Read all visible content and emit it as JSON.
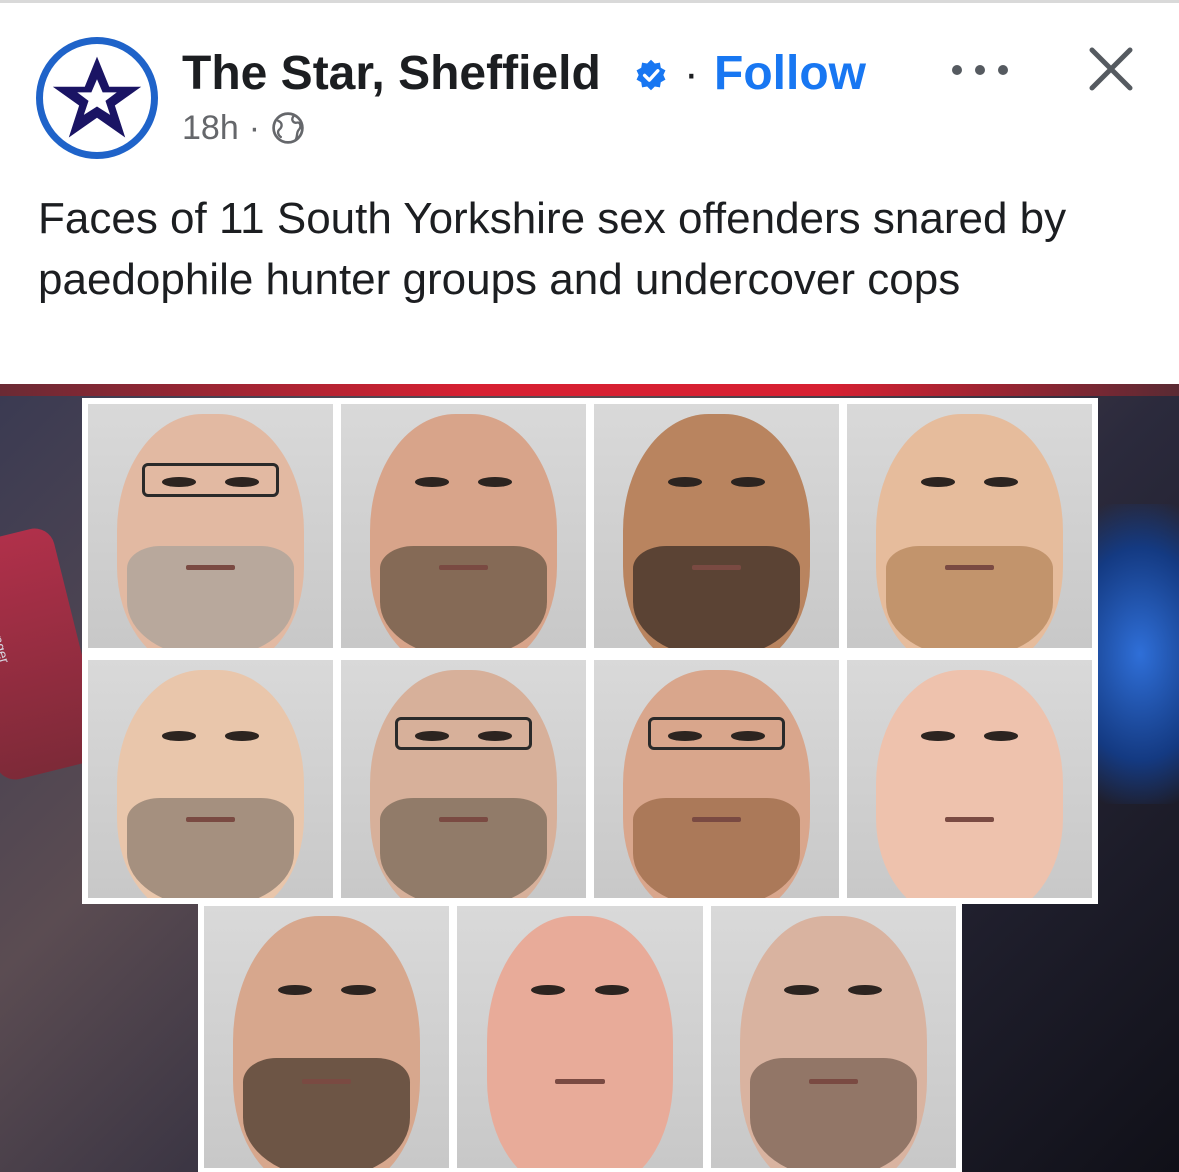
{
  "post": {
    "page_name": "The Star, Sheffield",
    "follow_label": "Follow",
    "separator": "·",
    "timestamp": "18h",
    "audience_icon": "globe-icon",
    "caption": "Faces of 11 South Yorkshire sex offenders snared by paedophile hunter groups and undercover cops"
  },
  "image": {
    "background_label": "Messenger",
    "mugshots": [
      {
        "skin": "#e2b9a2",
        "beard": "#a9a39a",
        "glasses": true
      },
      {
        "skin": "#d8a48a",
        "beard": "#6a5744",
        "glasses": false
      },
      {
        "skin": "#b9845f",
        "beard": "#3c2e26",
        "glasses": false
      },
      {
        "skin": "#e6bc9c",
        "beard": "#b5875c",
        "glasses": false
      },
      {
        "skin": "#e9c6ab",
        "beard": "#8d7d70",
        "glasses": false
      },
      {
        "skin": "#d7b09a",
        "beard": "#7a6a58",
        "glasses": true
      },
      {
        "skin": "#d9a68c",
        "beard": "#9b6a48",
        "glasses": true
      },
      {
        "skin": "#eec2ad",
        "beard": "",
        "glasses": false
      },
      {
        "skin": "#d7a78d",
        "beard": "#4a3a2e",
        "glasses": false
      },
      {
        "skin": "#e8ab99",
        "beard": "",
        "glasses": false
      },
      {
        "skin": "#d9b3a0",
        "beard": "#7a6254",
        "glasses": false
      }
    ]
  },
  "colors": {
    "brand_blue": "#1877f2",
    "verified_blue": "#1877f2",
    "avatar_ring": "#1f63c9",
    "star_navy": "#1a1464",
    "text_primary": "#1c1e21",
    "text_secondary": "#65676b"
  }
}
